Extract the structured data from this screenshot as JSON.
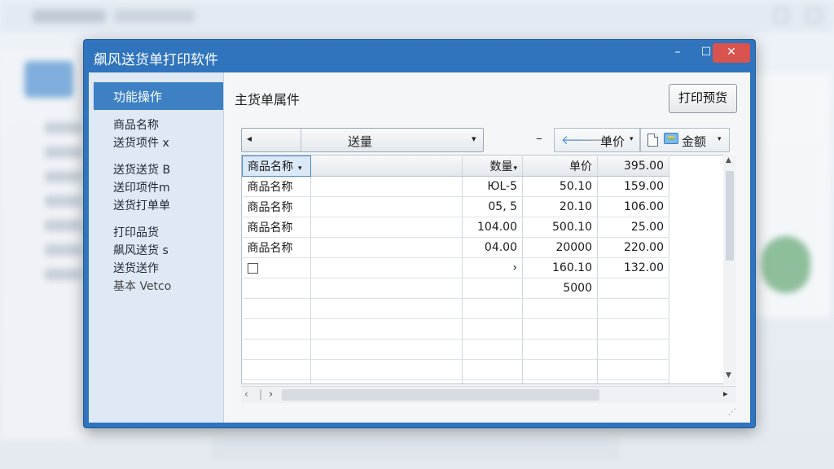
{
  "window": {
    "title": "飙风送货单打印软件",
    "controls": {
      "minimize": "–",
      "maximize": "☐",
      "close": "✕"
    }
  },
  "sidebar": {
    "active_item": "功能操作",
    "items": [
      "商品名称",
      "送货项件 x",
      "送货送货 B",
      "送印项件m",
      "送货打单单",
      "打印品货",
      "飙风送货 s",
      "送货送作",
      "基本 Vetco"
    ]
  },
  "content": {
    "title": "主货单属件",
    "print_button": "打印预货"
  },
  "toolbar": {
    "combo_left_icon": "◂",
    "combo_value": "送量",
    "combo_arrow": "▾",
    "minus": "–",
    "nav_prev_icon": "arrow-left-icon",
    "nav_next_icon": "arrow-right-icon",
    "price_label": "单价",
    "price_caret": "▾",
    "doc_icon": "document-icon",
    "chat_icon": "comment-icon",
    "amount_label": "金额",
    "amount_caret": "▾"
  },
  "grid": {
    "headers": {
      "name": "商品名称",
      "qty": "数量",
      "price": "单价",
      "amount": "395.00"
    },
    "header_carets": {
      "name": "▾",
      "qty": "▾"
    },
    "rows": [
      {
        "name": "商品名称",
        "qty": "ЮL-5",
        "price": "50.10",
        "amount": "159.00"
      },
      {
        "name": "商品名称",
        "qty": "05, 5",
        "price": "20.10",
        "amount": "106.00"
      },
      {
        "name": "商品名称",
        "qty": "104.00",
        "price": "500.10",
        "amount": "25.00"
      },
      {
        "name": "商品名称",
        "qty": "04.00",
        "price": "20000",
        "amount": "220.00"
      },
      {
        "name": "",
        "qty": "›",
        "price": "160.10",
        "amount": "132.00",
        "checkbox": true
      },
      {
        "name": "",
        "qty": "",
        "price": "5000",
        "amount": ""
      },
      {
        "name": "",
        "qty": "",
        "price": "",
        "amount": ""
      },
      {
        "name": "",
        "qty": "",
        "price": "",
        "amount": ""
      },
      {
        "name": "",
        "qty": "",
        "price": "",
        "amount": ""
      },
      {
        "name": "",
        "qty": "",
        "price": "",
        "amount": ""
      },
      {
        "name": "",
        "qty": "",
        "price": "",
        "amount": ""
      }
    ]
  },
  "scroll": {
    "up": "▲",
    "down": "▼",
    "left": "‹",
    "right": "›",
    "end": "▸"
  }
}
